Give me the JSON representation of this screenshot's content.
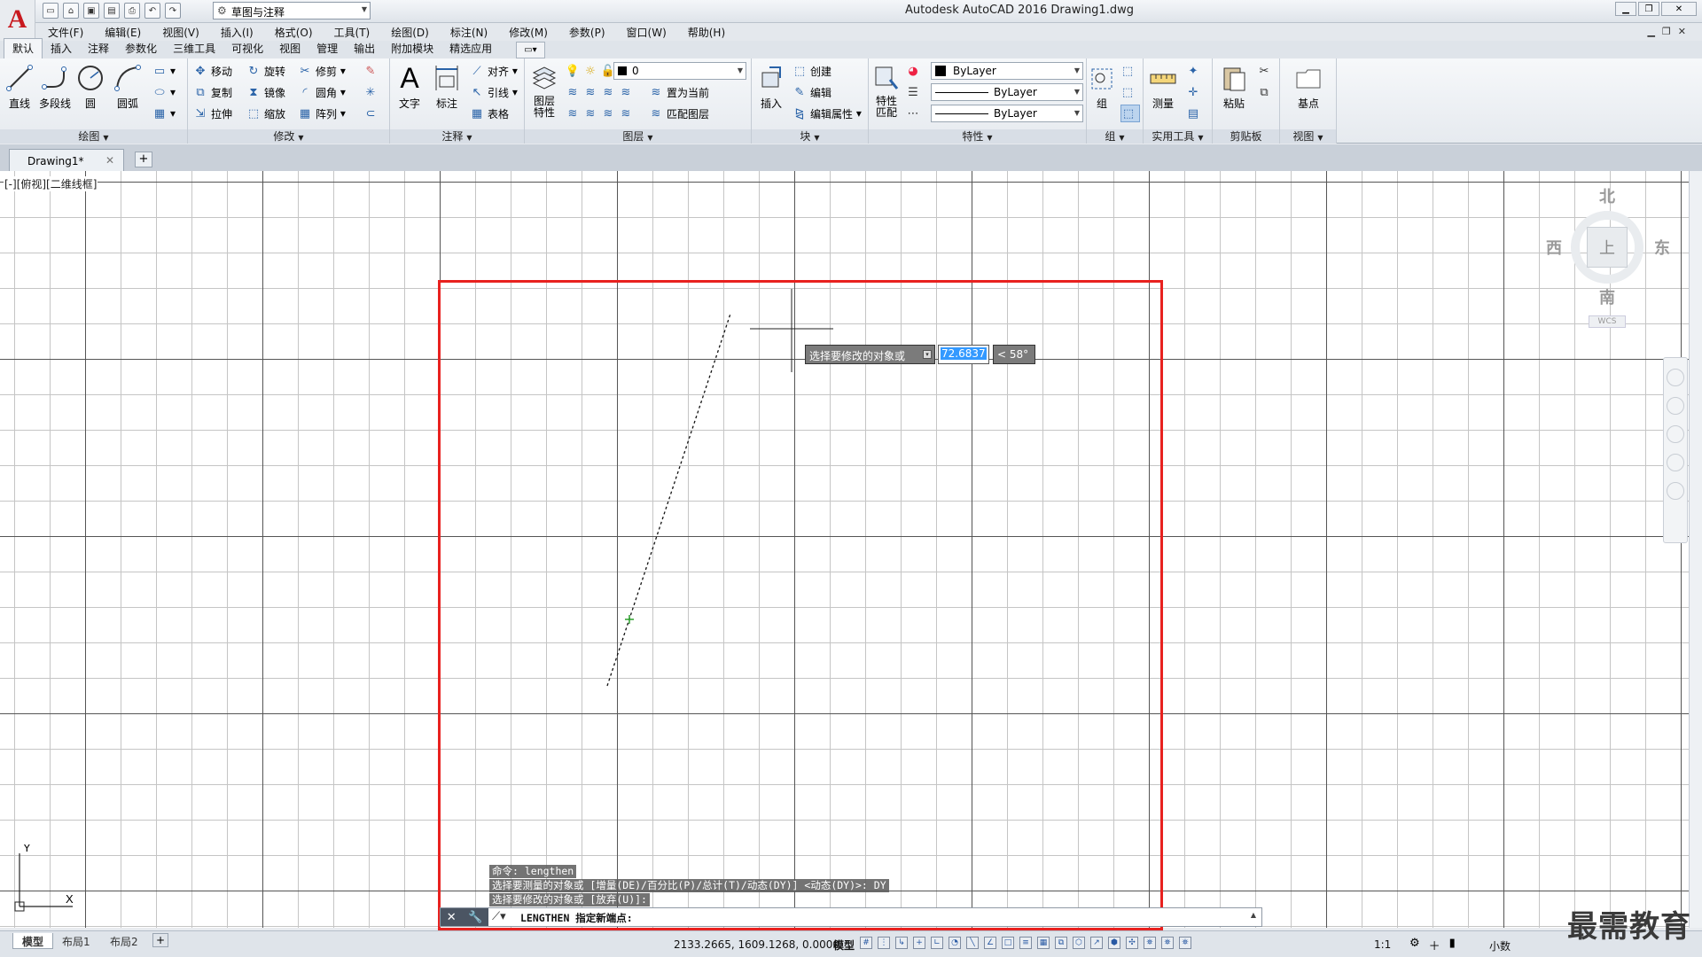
{
  "window": {
    "title": "Autodesk AutoCAD 2016    Drawing1.dwg",
    "workspace": "草图与注释"
  },
  "menu": [
    "文件(F)",
    "编辑(E)",
    "视图(V)",
    "插入(I)",
    "格式(O)",
    "工具(T)",
    "绘图(D)",
    "标注(N)",
    "修改(M)",
    "参数(P)",
    "窗口(W)",
    "帮助(H)"
  ],
  "ribbon_tabs": [
    "默认",
    "插入",
    "注释",
    "参数化",
    "三维工具",
    "可视化",
    "视图",
    "管理",
    "输出",
    "附加模块",
    "精选应用"
  ],
  "ribbon": {
    "draw": {
      "title": "绘图",
      "line": "直线",
      "polyline": "多段线",
      "circle": "圆",
      "arc": "圆弧"
    },
    "modify": {
      "title": "修改",
      "move": "移动",
      "rotate": "旋转",
      "trim": "修剪",
      "copy": "复制",
      "mirror": "镜像",
      "fillet": "圆角",
      "stretch": "拉伸",
      "scale": "缩放",
      "array": "阵列"
    },
    "annotation": {
      "title": "注释",
      "text": "文字",
      "dimension": "标注",
      "align": "对齐",
      "leader": "引线",
      "table": "表格"
    },
    "layers": {
      "title": "图层",
      "properties": "图层\n特性",
      "current_layer": "0",
      "set_current": "置为当前",
      "match": "匹配图层"
    },
    "block": {
      "title": "块",
      "insert": "插入",
      "create": "创建",
      "edit": "编辑",
      "edit_attr": "编辑属性"
    },
    "properties": {
      "title": "特性",
      "match": "特性\n匹配",
      "color": "ByLayer",
      "linetype": "ByLayer",
      "lineweight": "ByLayer"
    },
    "groups": {
      "title": "组",
      "group": "组"
    },
    "utilities": {
      "title": "实用工具",
      "measure": "测量"
    },
    "clipboard": {
      "title": "剪贴板",
      "paste": "粘贴"
    },
    "view": {
      "title": "视图",
      "base": "基点"
    }
  },
  "doc_tab": "Drawing1*",
  "viewport_label": "[-][俯视][二维线框]",
  "viewcube": {
    "north": "北",
    "south": "南",
    "east": "东",
    "west": "西",
    "top": "上",
    "wcs": "WCS"
  },
  "dynamic_input": {
    "prompt": "选择要修改的对象或",
    "value": "72.6837",
    "angle": "< 58°"
  },
  "command_history": [
    "命令:  lengthen",
    "选择要测量的对象或 [增量(DE)/百分比(P)/总计(T)/动态(DY)] <动态(DY)>: DY",
    "选择要修改的对象或 [放弃(U)]:"
  ],
  "command_line": "LENGTHEN 指定新端点:",
  "layout_tabs": [
    "模型",
    "布局1",
    "布局2"
  ],
  "status": {
    "coordinates": "2133.2665, 1609.1268, 0.0000",
    "space": "模型",
    "scale": "1:1",
    "units": "小数"
  },
  "watermark": "最需教育",
  "colors": {
    "highlight_box": "#e8211f",
    "canvas_bg": "#ffffff",
    "selection_blue": "#3399ff"
  }
}
